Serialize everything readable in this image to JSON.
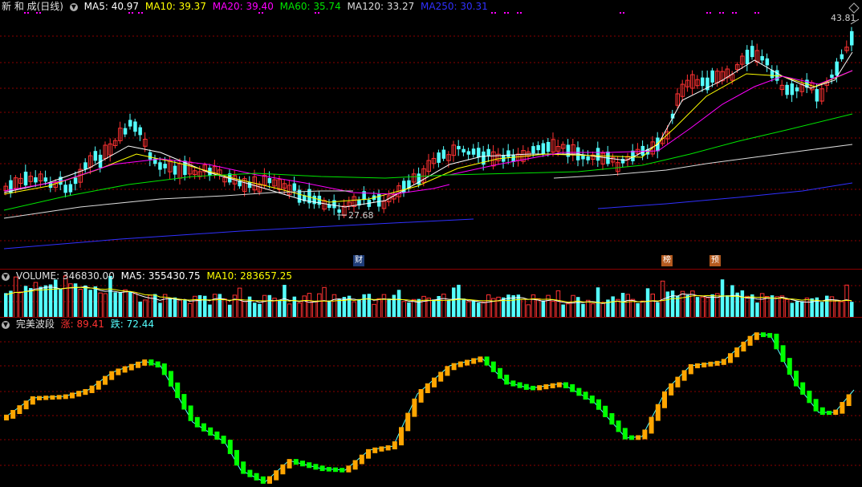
{
  "main_legend": {
    "stock_name": "新 和 成(日线)",
    "ma5": "MA5: 40.97",
    "ma10": "MA10: 39.37",
    "ma20": "MA20: 39.40",
    "ma60": "MA60: 35.74",
    "ma120": "MA120: 33.27",
    "ma250": "MA250: 30.31"
  },
  "annotations": {
    "high_price": "43.81",
    "low_price": "27.68",
    "badge_cai": "财",
    "badge_bang": "榜",
    "badge_yu": "预"
  },
  "volume_legend": {
    "title": "VOLUME: 346830.00",
    "ma5": "MA5: 355430.75",
    "ma10": "MA10: 283657.25"
  },
  "indicator_legend": {
    "name": "完美波段",
    "up_label": "涨:",
    "up_value": "89.41",
    "down_label": "跌:",
    "down_value": "72.44"
  },
  "colors": {
    "up": "#ff3232",
    "down": "#54ffff",
    "ma5": "#ffffff",
    "ma10": "#ffff00",
    "ma20": "#ff00ff",
    "ma60": "#00e600",
    "ma120": "#dcdcdc",
    "ma250": "#3030ff",
    "wave_up": "#ffa500",
    "wave_down": "#00ff00"
  },
  "chart_data": {
    "type": "candlestick",
    "title": "新和成(日线)",
    "price_markers": {
      "high": 43.81,
      "low": 27.68
    },
    "moving_averages": {
      "MA5": 40.97,
      "MA10": 39.37,
      "MA20": 39.4,
      "MA60": 35.74,
      "MA120": 33.27,
      "MA250": 30.31
    },
    "volume": {
      "VOLUME": 346830.0,
      "MA5": 355430.75,
      "MA10": 283657.25
    },
    "indicator": {
      "name": "完美波段",
      "涨": 89.41,
      "跌": 72.44
    }
  }
}
